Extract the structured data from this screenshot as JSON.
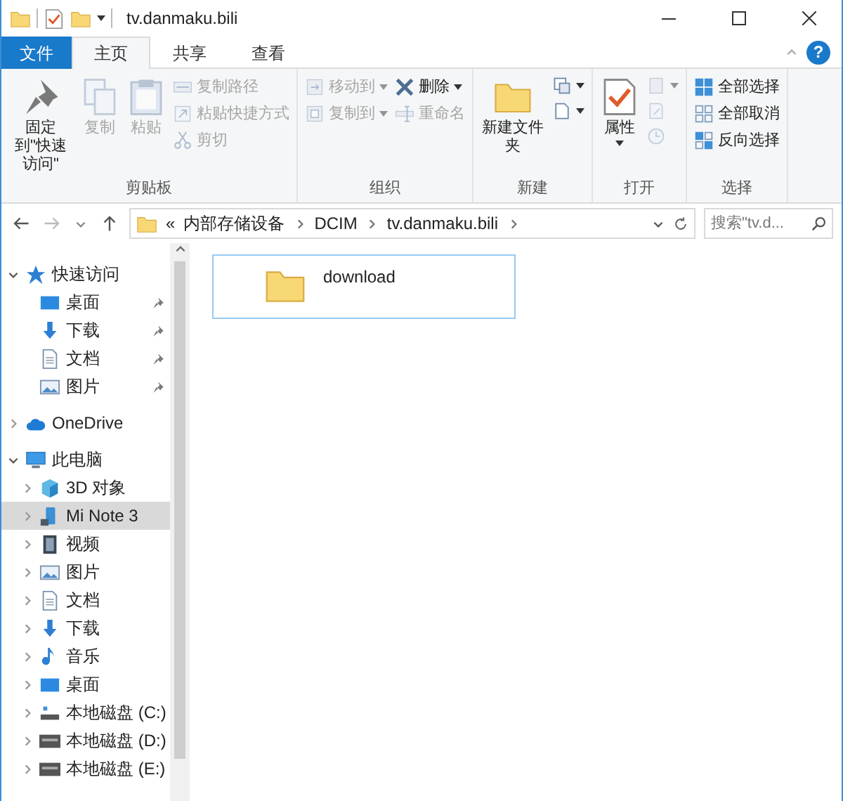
{
  "window": {
    "title": "tv.danmaku.bili"
  },
  "tabs": [
    {
      "label": "文件",
      "kind": "file",
      "selected": false
    },
    {
      "label": "主页",
      "kind": "tab",
      "selected": true
    },
    {
      "label": "共享",
      "kind": "tab",
      "selected": false
    },
    {
      "label": "查看",
      "kind": "tab",
      "selected": false
    }
  ],
  "help": "?",
  "ribbon": {
    "groups": [
      {
        "label": "剪贴板",
        "buttons": [
          {
            "label": "固定到\"快速访问\"",
            "kind": "pin",
            "disabled": false,
            "dropdown": false
          },
          {
            "label": "复制",
            "kind": "copy",
            "disabled": true,
            "dropdown": false
          },
          {
            "label": "粘贴",
            "kind": "paste",
            "disabled": true,
            "dropdown": false
          }
        ],
        "columns": [
          [
            {
              "label": "复制路径",
              "kind": "copy-path",
              "disabled": true,
              "dropdown": false
            },
            {
              "label": "粘贴快捷方式",
              "kind": "shortcut",
              "disabled": true,
              "dropdown": false
            },
            {
              "label": "剪切",
              "kind": "cut",
              "disabled": true,
              "dropdown": false
            }
          ]
        ]
      },
      {
        "label": "组织",
        "columns": [
          [
            {
              "label": "移动到",
              "kind": "move",
              "disabled": true,
              "dropdown": true
            },
            {
              "label": "复制到",
              "kind": "copy-to",
              "disabled": true,
              "dropdown": true
            }
          ],
          [
            {
              "label": "删除",
              "kind": "delete",
              "disabled": false,
              "dropdown": true
            },
            {
              "label": "重命名",
              "kind": "rename",
              "disabled": true,
              "dropdown": false
            }
          ]
        ]
      },
      {
        "label": "新建",
        "buttons": [
          {
            "label": "新建文件夹",
            "kind": "new-folder",
            "disabled": false,
            "dropdown": false
          }
        ],
        "columns": [
          [
            {
              "kind": "new-item",
              "disabled": false,
              "dropdown": true
            },
            {
              "kind": "easy-access",
              "disabled": false,
              "dropdown": true
            }
          ]
        ]
      },
      {
        "label": "打开",
        "buttons": [
          {
            "label": "属性",
            "kind": "properties",
            "disabled": false,
            "dropdown": true
          }
        ],
        "columns": [
          [
            {
              "kind": "open",
              "disabled": true,
              "dropdown": true
            },
            {
              "kind": "edit",
              "disabled": true,
              "dropdown": false
            },
            {
              "kind": "history",
              "disabled": true,
              "dropdown": false
            }
          ]
        ]
      },
      {
        "label": "选择",
        "columns": [
          [
            {
              "label": "全部选择",
              "kind": "select-all",
              "disabled": false,
              "dropdown": false
            },
            {
              "label": "全部取消",
              "kind": "select-none",
              "disabled": false,
              "dropdown": false
            },
            {
              "label": "反向选择",
              "kind": "invert",
              "disabled": false,
              "dropdown": false
            }
          ]
        ]
      }
    ]
  },
  "address": {
    "overflow": "«",
    "segments": [
      "内部存储设备",
      "DCIM",
      "tv.danmaku.bili"
    ]
  },
  "search": {
    "placeholder": "搜索\"tv.d..."
  },
  "nav": [
    {
      "label": "快速访问",
      "kind": "star",
      "expanded": true,
      "selected": false,
      "children": [
        {
          "label": "桌面",
          "kind": "desktop",
          "selected": false,
          "pinned": true
        },
        {
          "label": "下载",
          "kind": "download",
          "selected": false,
          "pinned": true
        },
        {
          "label": "文档",
          "kind": "documents",
          "selected": false,
          "pinned": true
        },
        {
          "label": "图片",
          "kind": "pictures",
          "selected": false,
          "pinned": true
        }
      ]
    },
    {
      "label": "OneDrive",
      "kind": "cloud",
      "expanded": false,
      "selected": false
    },
    {
      "label": "此电脑",
      "kind": "pc",
      "expanded": true,
      "selected": false,
      "children": [
        {
          "label": "3D 对象",
          "kind": "cube",
          "expanded": false,
          "selected": false
        },
        {
          "label": "Mi Note 3",
          "kind": "phone",
          "expanded": false,
          "selected": true
        },
        {
          "label": "视频",
          "kind": "video",
          "expanded": false,
          "selected": false
        },
        {
          "label": "图片",
          "kind": "pictures",
          "expanded": false,
          "selected": false
        },
        {
          "label": "文档",
          "kind": "documents",
          "expanded": false,
          "selected": false
        },
        {
          "label": "下载",
          "kind": "download",
          "expanded": false,
          "selected": false
        },
        {
          "label": "音乐",
          "kind": "music",
          "expanded": false,
          "selected": false
        },
        {
          "label": "桌面",
          "kind": "desktop",
          "expanded": false,
          "selected": false
        },
        {
          "label": "本地磁盘 (C:)",
          "kind": "system-drive",
          "expanded": false,
          "selected": false
        },
        {
          "label": "本地磁盘 (D:)",
          "kind": "drive",
          "expanded": false,
          "selected": false
        },
        {
          "label": "本地磁盘 (E:)",
          "kind": "drive",
          "expanded": false,
          "selected": false
        }
      ]
    }
  ],
  "files": [
    {
      "name": "download",
      "focused": true
    }
  ]
}
